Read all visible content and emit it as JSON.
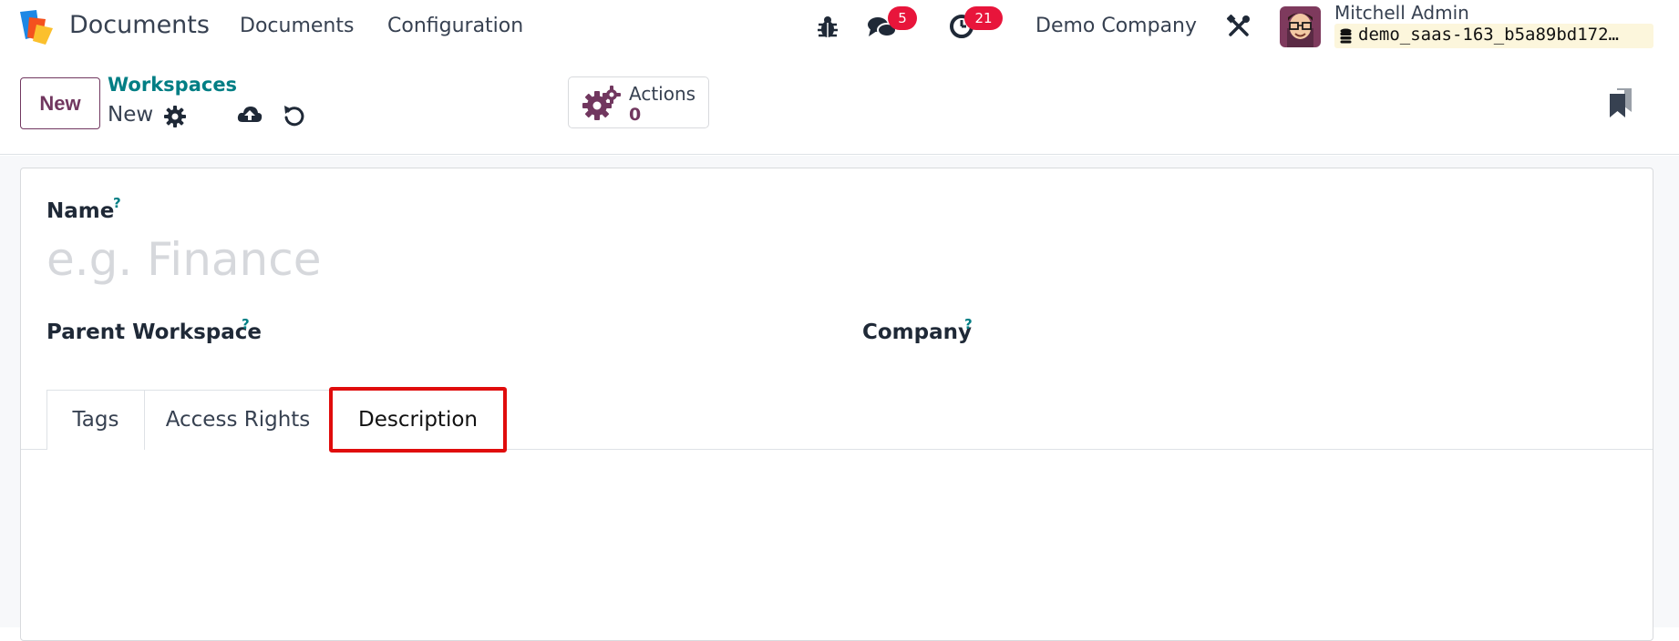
{
  "navbar": {
    "app_name": "Documents",
    "menus": [
      "Documents",
      "Configuration"
    ],
    "messages_count": "5",
    "activities_count": "21",
    "company": "Demo Company",
    "user_name": "Mitchell Admin",
    "database": "demo_saas-163_b5a89bd172…"
  },
  "control_panel": {
    "new_button": "New",
    "breadcrumb_parent": "Workspaces",
    "breadcrumb_current": "New",
    "actions_label": "Actions",
    "actions_count": "0"
  },
  "form": {
    "name_label": "Name",
    "name_placeholder": "e.g. Finance",
    "help_mark": "?",
    "parent_label": "Parent Workspace",
    "company_label": "Company",
    "tabs": [
      "Tags",
      "Access Rights",
      "Description"
    ]
  },
  "colors": {
    "brand": "#71375f",
    "link": "#017e84",
    "badge": "#e8153b",
    "highlight": "#e00c0c"
  },
  "icons": [
    "app-logo-icon",
    "bug-icon",
    "chat-icon",
    "clock-icon",
    "tools-icon",
    "database-icon",
    "gear-icon",
    "cloud-upload-icon",
    "undo-icon",
    "gears-icon",
    "bookmarks-icon"
  ]
}
